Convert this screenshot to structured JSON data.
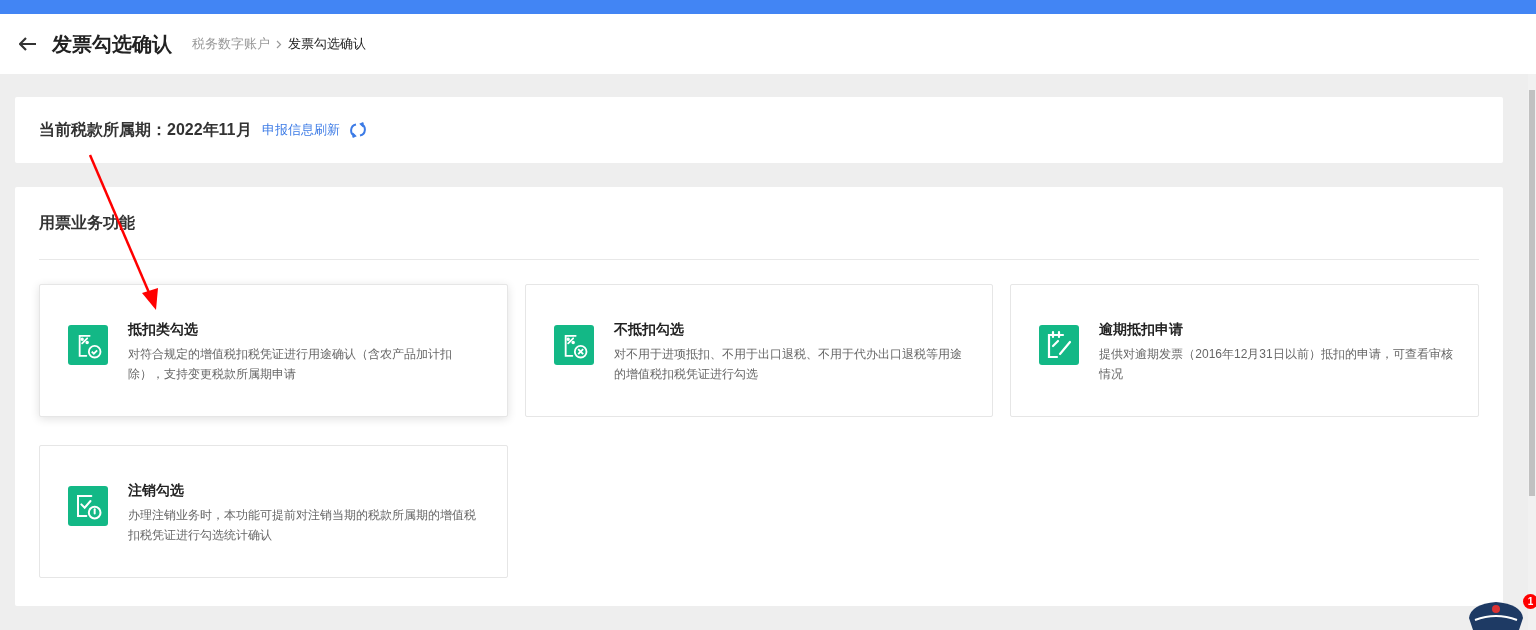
{
  "header": {
    "title": "发票勾选确认",
    "breadcrumb": [
      {
        "label": "税务数字账户",
        "current": false
      },
      {
        "label": "发票勾选确认",
        "current": true
      }
    ]
  },
  "period": {
    "label": "当前税款所属期：2022年11月",
    "refresh_link": "申报信息刷新"
  },
  "functions": {
    "title": "用票业务功能",
    "cards": [
      {
        "kind": "check",
        "title": "抵扣类勾选",
        "description": "对符合规定的增值税扣税凭证进行用途确认（含农产品加计扣除），支持变更税款所属期申请",
        "highlighted": true
      },
      {
        "kind": "cross",
        "title": "不抵扣勾选",
        "description": "对不用于进项抵扣、不用于出口退税、不用于代办出口退税等用途的增值税扣税凭证进行勾选",
        "highlighted": false
      },
      {
        "kind": "edit",
        "title": "逾期抵扣申请",
        "description": "提供对逾期发票（2016年12月31日以前）抵扣的申请，可查看审核情况",
        "highlighted": false
      },
      {
        "kind": "power",
        "title": "注销勾选",
        "description": "办理注销业务时，本功能可提前对注销当期的税款所属期的增值税扣税凭证进行勾选统计确认",
        "highlighted": false
      }
    ]
  },
  "assistant": {
    "badge": "1"
  }
}
